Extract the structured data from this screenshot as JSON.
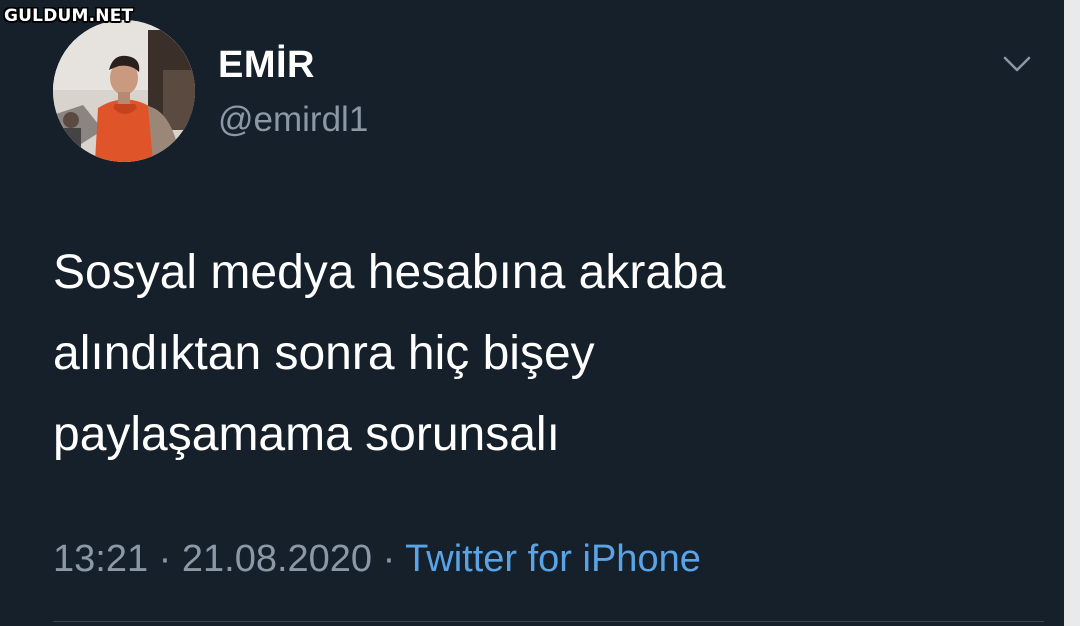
{
  "watermark": "GULDUM.NET",
  "tweet": {
    "display_name": "EMİR",
    "handle": "@emirdl1",
    "text_lines": [
      "Sosyal medya hesabına akraba",
      "alındıktan sonra hiç bişey",
      "paylaşamama sorunsalı"
    ],
    "time": "13:21",
    "separator": "·",
    "date": "21.08.2020",
    "source": "Twitter for iPhone"
  },
  "icons": {
    "menu": "chevron-down-icon",
    "avatar": "profile-photo"
  },
  "colors": {
    "background": "#15202b",
    "text": "#ffffff",
    "secondary": "#8b98a5",
    "link": "#5aa3e6"
  }
}
